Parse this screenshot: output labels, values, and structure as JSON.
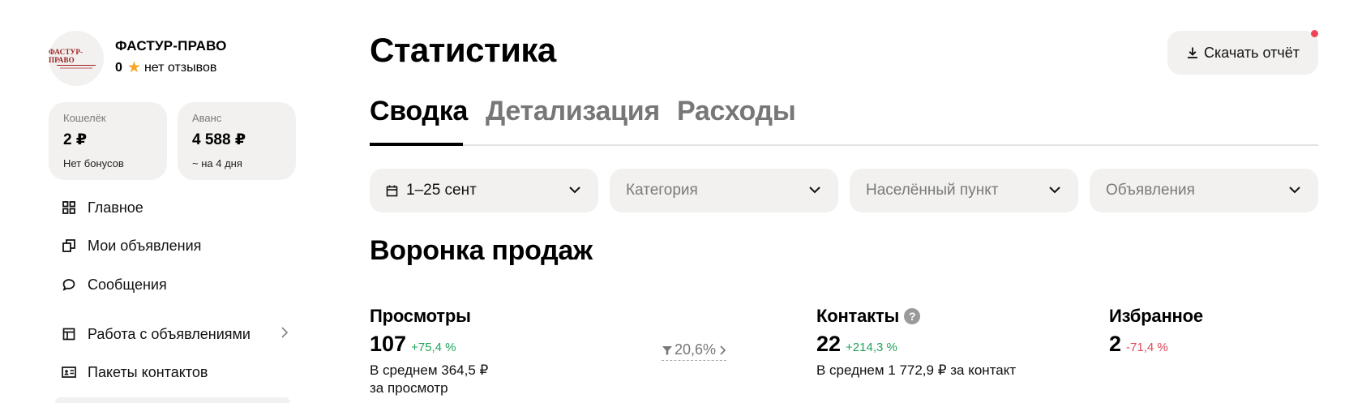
{
  "profile": {
    "logo_text": "ФАСТУР-ПРАВО",
    "name": "ФАСТУР-ПРАВО",
    "rating": "0",
    "rating_text": "нет отзывов"
  },
  "wallet": {
    "label": "Кошелёк",
    "value": "2 ₽",
    "sub": "Нет бонусов"
  },
  "advance": {
    "label": "Аванс",
    "value": "4 588 ₽",
    "sub": "~ на 4 дня"
  },
  "nav": {
    "items": [
      {
        "label": "Главное",
        "icon": "grid-icon"
      },
      {
        "label": "Мои объявления",
        "icon": "copy-icon"
      },
      {
        "label": "Сообщения",
        "icon": "chat-icon"
      },
      {
        "label": "Работа с объявлениями",
        "icon": "table-icon"
      },
      {
        "label": "Пакеты контактов",
        "icon": "contact-card-icon"
      }
    ]
  },
  "header": {
    "title": "Статистика",
    "download_label": "Скачать отчёт"
  },
  "tabs": [
    {
      "label": "Сводка",
      "active": true
    },
    {
      "label": "Детализация",
      "active": false
    },
    {
      "label": "Расходы",
      "active": false
    }
  ],
  "filters": {
    "period": "1–25 сент",
    "category": "Категория",
    "city": "Населённый пункт",
    "ads": "Объявления"
  },
  "funnel": {
    "title": "Воронка продаж",
    "views": {
      "title": "Просмотры",
      "value": "107",
      "delta": "+75,4 %",
      "desc_line1": "В среднем 364,5 ₽",
      "desc_line2": "за просмотр"
    },
    "conversion": "20,6%",
    "contacts": {
      "title": "Контакты",
      "value": "22",
      "delta": "+214,3 %",
      "desc": "В среднем 1 772,9 ₽ за контакт"
    },
    "favorites": {
      "title": "Избранное",
      "value": "2",
      "delta": "-71,4 %"
    }
  },
  "colors": {
    "positive": "#22a35a",
    "negative": "#e0485b",
    "notification": "#ee4455",
    "surface": "#f2f1ef"
  }
}
